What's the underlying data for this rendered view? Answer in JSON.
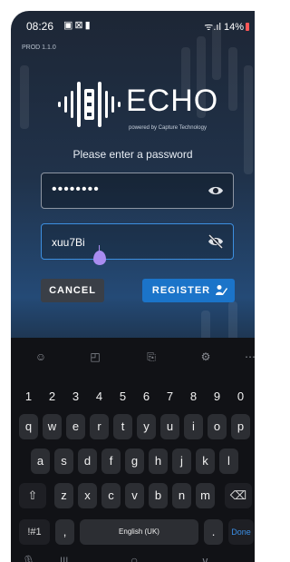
{
  "status_bar": {
    "time": "08:26",
    "notification_icons": [
      "gallery-icon",
      "photo-icon",
      "lock-icon"
    ],
    "signal_text": "ᯤ.ıl",
    "battery": "14%",
    "battery_color": "#ff5757"
  },
  "app": {
    "version": "PROD 1.1.0",
    "logo_title": "ECHO",
    "logo_subtitle": "powered by Capture Technology",
    "prompt": "Please enter a password"
  },
  "form": {
    "password_masked": "••••••••",
    "confirm_value": "xuu7Bi",
    "show_password_icon": "eye-icon",
    "hide_password_icon": "eye-off-icon",
    "accent": "#3d8fe0",
    "cancel_label": "CANCEL",
    "register_label": "REGISTER",
    "register_icon": "person-edit-icon"
  },
  "keyboard": {
    "toolbar": [
      "emoji-icon",
      "sticker-icon",
      "clipboard-icon",
      "settings-icon",
      "more-icon"
    ],
    "numbers": [
      "1",
      "2",
      "3",
      "4",
      "5",
      "6",
      "7",
      "8",
      "9",
      "0"
    ],
    "row1": [
      "q",
      "w",
      "e",
      "r",
      "t",
      "y",
      "u",
      "i",
      "o",
      "p"
    ],
    "row2": [
      "a",
      "s",
      "d",
      "f",
      "g",
      "h",
      "j",
      "k",
      "l"
    ],
    "row3": [
      "z",
      "x",
      "c",
      "v",
      "b",
      "n",
      "m"
    ],
    "shift_symbol": "⇧",
    "backspace_symbol": "⌫",
    "symbols_label": "!#1",
    "comma": ",",
    "space_label": "English (UK)",
    "period": ".",
    "done_label": "Done"
  },
  "navbar": {
    "mic": "🎙",
    "recents": "|||",
    "home": "○",
    "back": "∨"
  }
}
